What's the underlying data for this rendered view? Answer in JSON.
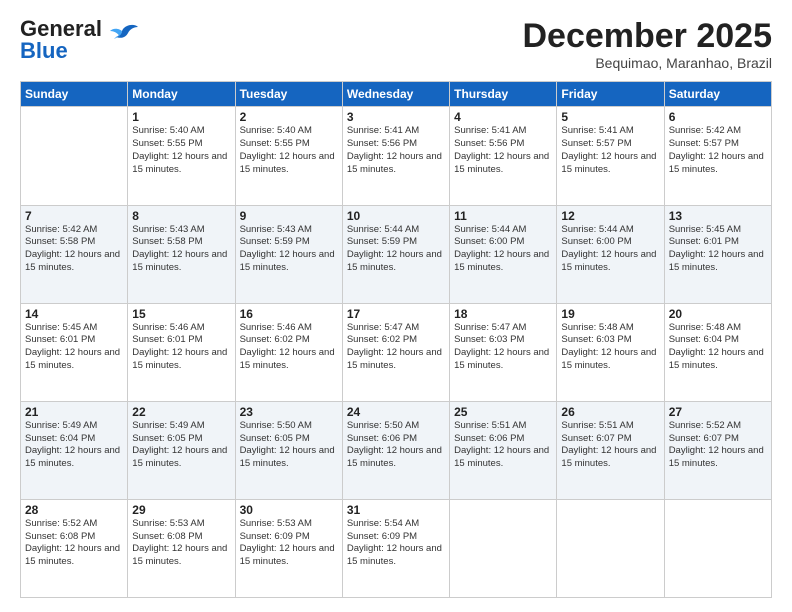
{
  "logo": {
    "line1": "General",
    "line2": "Blue"
  },
  "title": "December 2025",
  "location": "Bequimao, Maranhao, Brazil",
  "days_of_week": [
    "Sunday",
    "Monday",
    "Tuesday",
    "Wednesday",
    "Thursday",
    "Friday",
    "Saturday"
  ],
  "weeks": [
    [
      {
        "day": "",
        "sunrise": "",
        "sunset": "",
        "daylight": ""
      },
      {
        "day": "1",
        "sunrise": "5:40 AM",
        "sunset": "5:55 PM",
        "daylight": "12 hours and 15 minutes."
      },
      {
        "day": "2",
        "sunrise": "5:40 AM",
        "sunset": "5:55 PM",
        "daylight": "12 hours and 15 minutes."
      },
      {
        "day": "3",
        "sunrise": "5:41 AM",
        "sunset": "5:56 PM",
        "daylight": "12 hours and 15 minutes."
      },
      {
        "day": "4",
        "sunrise": "5:41 AM",
        "sunset": "5:56 PM",
        "daylight": "12 hours and 15 minutes."
      },
      {
        "day": "5",
        "sunrise": "5:41 AM",
        "sunset": "5:57 PM",
        "daylight": "12 hours and 15 minutes."
      },
      {
        "day": "6",
        "sunrise": "5:42 AM",
        "sunset": "5:57 PM",
        "daylight": "12 hours and 15 minutes."
      }
    ],
    [
      {
        "day": "7",
        "sunrise": "5:42 AM",
        "sunset": "5:58 PM",
        "daylight": "12 hours and 15 minutes."
      },
      {
        "day": "8",
        "sunrise": "5:43 AM",
        "sunset": "5:58 PM",
        "daylight": "12 hours and 15 minutes."
      },
      {
        "day": "9",
        "sunrise": "5:43 AM",
        "sunset": "5:59 PM",
        "daylight": "12 hours and 15 minutes."
      },
      {
        "day": "10",
        "sunrise": "5:44 AM",
        "sunset": "5:59 PM",
        "daylight": "12 hours and 15 minutes."
      },
      {
        "day": "11",
        "sunrise": "5:44 AM",
        "sunset": "6:00 PM",
        "daylight": "12 hours and 15 minutes."
      },
      {
        "day": "12",
        "sunrise": "5:44 AM",
        "sunset": "6:00 PM",
        "daylight": "12 hours and 15 minutes."
      },
      {
        "day": "13",
        "sunrise": "5:45 AM",
        "sunset": "6:01 PM",
        "daylight": "12 hours and 15 minutes."
      }
    ],
    [
      {
        "day": "14",
        "sunrise": "5:45 AM",
        "sunset": "6:01 PM",
        "daylight": "12 hours and 15 minutes."
      },
      {
        "day": "15",
        "sunrise": "5:46 AM",
        "sunset": "6:01 PM",
        "daylight": "12 hours and 15 minutes."
      },
      {
        "day": "16",
        "sunrise": "5:46 AM",
        "sunset": "6:02 PM",
        "daylight": "12 hours and 15 minutes."
      },
      {
        "day": "17",
        "sunrise": "5:47 AM",
        "sunset": "6:02 PM",
        "daylight": "12 hours and 15 minutes."
      },
      {
        "day": "18",
        "sunrise": "5:47 AM",
        "sunset": "6:03 PM",
        "daylight": "12 hours and 15 minutes."
      },
      {
        "day": "19",
        "sunrise": "5:48 AM",
        "sunset": "6:03 PM",
        "daylight": "12 hours and 15 minutes."
      },
      {
        "day": "20",
        "sunrise": "5:48 AM",
        "sunset": "6:04 PM",
        "daylight": "12 hours and 15 minutes."
      }
    ],
    [
      {
        "day": "21",
        "sunrise": "5:49 AM",
        "sunset": "6:04 PM",
        "daylight": "12 hours and 15 minutes."
      },
      {
        "day": "22",
        "sunrise": "5:49 AM",
        "sunset": "6:05 PM",
        "daylight": "12 hours and 15 minutes."
      },
      {
        "day": "23",
        "sunrise": "5:50 AM",
        "sunset": "6:05 PM",
        "daylight": "12 hours and 15 minutes."
      },
      {
        "day": "24",
        "sunrise": "5:50 AM",
        "sunset": "6:06 PM",
        "daylight": "12 hours and 15 minutes."
      },
      {
        "day": "25",
        "sunrise": "5:51 AM",
        "sunset": "6:06 PM",
        "daylight": "12 hours and 15 minutes."
      },
      {
        "day": "26",
        "sunrise": "5:51 AM",
        "sunset": "6:07 PM",
        "daylight": "12 hours and 15 minutes."
      },
      {
        "day": "27",
        "sunrise": "5:52 AM",
        "sunset": "6:07 PM",
        "daylight": "12 hours and 15 minutes."
      }
    ],
    [
      {
        "day": "28",
        "sunrise": "5:52 AM",
        "sunset": "6:08 PM",
        "daylight": "12 hours and 15 minutes."
      },
      {
        "day": "29",
        "sunrise": "5:53 AM",
        "sunset": "6:08 PM",
        "daylight": "12 hours and 15 minutes."
      },
      {
        "day": "30",
        "sunrise": "5:53 AM",
        "sunset": "6:09 PM",
        "daylight": "12 hours and 15 minutes."
      },
      {
        "day": "31",
        "sunrise": "5:54 AM",
        "sunset": "6:09 PM",
        "daylight": "12 hours and 15 minutes."
      },
      {
        "day": "",
        "sunrise": "",
        "sunset": "",
        "daylight": ""
      },
      {
        "day": "",
        "sunrise": "",
        "sunset": "",
        "daylight": ""
      },
      {
        "day": "",
        "sunrise": "",
        "sunset": "",
        "daylight": ""
      }
    ]
  ],
  "labels": {
    "sunrise": "Sunrise:",
    "sunset": "Sunset:",
    "daylight": "Daylight:"
  }
}
